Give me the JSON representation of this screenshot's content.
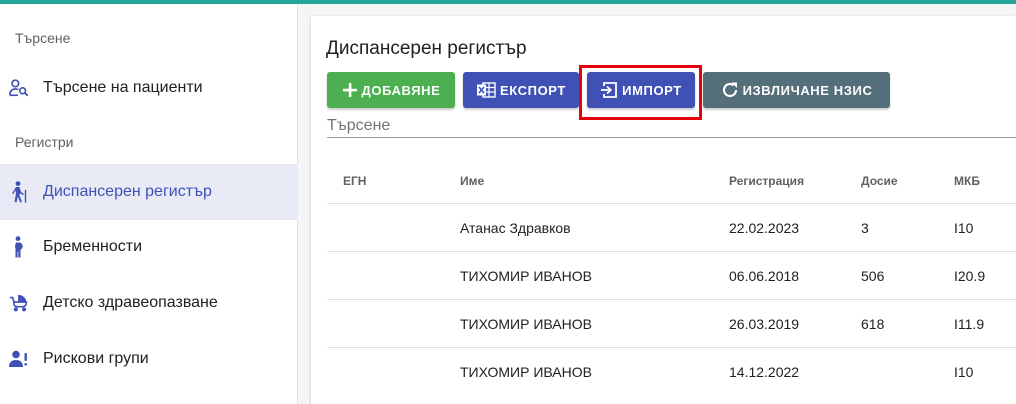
{
  "sidebar": {
    "section_search": "Търсене",
    "section_registers": "Регистри",
    "items": [
      {
        "label": "Търсене на пациенти",
        "icon": "patient-search-icon"
      },
      {
        "label": "Диспансерен регистър",
        "icon": "walking-person-icon"
      },
      {
        "label": "Бременности",
        "icon": "pregnant-woman-icon"
      },
      {
        "label": "Детско здравеопазване",
        "icon": "baby-carriage-icon"
      },
      {
        "label": "Рискови групи",
        "icon": "user-group-icon"
      }
    ]
  },
  "main": {
    "title": "Диспансерен регистър",
    "buttons": {
      "add": "ДОБАВЯНЕ",
      "export": "ЕКСПОРТ",
      "import": "ИМПОРТ",
      "nzis": "ИЗВЛИЧАНЕ НЗИС"
    },
    "search_label": "Търсене"
  },
  "table": {
    "headers": [
      "ЕГН",
      "Име",
      "Регистрация",
      "Досие",
      "МКБ"
    ],
    "rows": [
      {
        "name": "Атанас Здравков",
        "registration": "22.02.2023",
        "dossier": "3",
        "mkb": "I10"
      },
      {
        "name": "ТИХОМИР ИВАНОВ",
        "registration": "06.06.2018",
        "dossier": "506",
        "mkb": "I20.9"
      },
      {
        "name": "ТИХОМИР ИВАНОВ",
        "registration": "26.03.2019",
        "dossier": "618",
        "mkb": "I11.9"
      },
      {
        "name": "ТИХОМИР ИВАНОВ",
        "registration": "14.12.2022",
        "dossier": "",
        "mkb": "I10"
      }
    ]
  },
  "colors": {
    "accent_top": "#26a69a",
    "primary": "#3f51b5",
    "success": "#4caf50",
    "secondary": "#546e7a",
    "highlight": "#e8000b"
  }
}
